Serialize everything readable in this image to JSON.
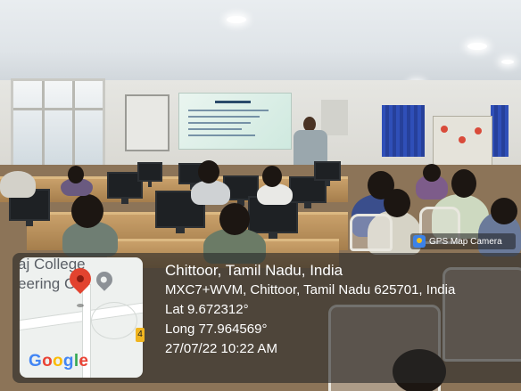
{
  "photo": {
    "description_icons": [
      "classroom-scene"
    ]
  },
  "overlay": {
    "badge_label": "GPS Map Camera",
    "location_title": "Chittoor, Tamil Nadu, India",
    "address": "MXC7+WVM, Chittoor, Tamil Nadu 625701, India",
    "latitude": "Lat 9.672312°",
    "longitude": "Long 77.964569°",
    "datetime": "27/07/22 10:22 AM",
    "map": {
      "text_line1": "aj College",
      "text_line2": "eering C",
      "road_marker": "4",
      "google_letters": [
        {
          "ch": "G",
          "color": "#4285F4"
        },
        {
          "ch": "o",
          "color": "#EA4335"
        },
        {
          "ch": "o",
          "color": "#FBBC05"
        },
        {
          "ch": "g",
          "color": "#4285F4"
        },
        {
          "ch": "l",
          "color": "#34A853"
        },
        {
          "ch": "e",
          "color": "#EA4335"
        }
      ]
    }
  }
}
